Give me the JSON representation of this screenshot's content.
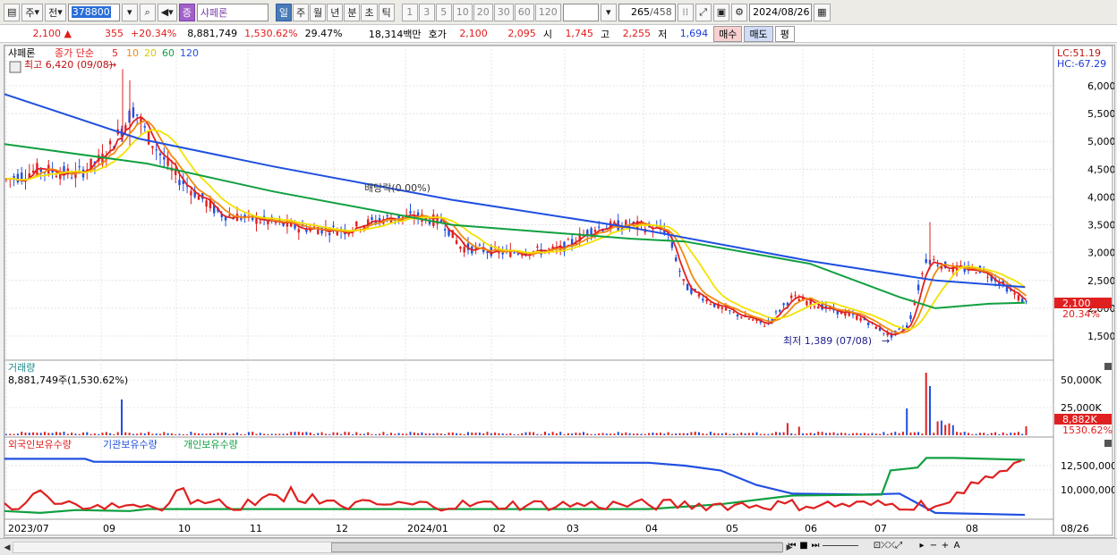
{
  "toolbar": {
    "period_type": "주",
    "prev_label": "전",
    "code": "378800",
    "stock_badge": "증",
    "stock_name": "샤페론",
    "periods": [
      "일",
      "주",
      "월",
      "년",
      "분",
      "초",
      "틱"
    ],
    "intervals": [
      "1",
      "3",
      "5",
      "10",
      "20",
      "30",
      "60",
      "120"
    ],
    "count": "265",
    "total": "/458",
    "date": "2024/08/26"
  },
  "infobar": {
    "price": "2,100",
    "change": "355",
    "change_pct": "+20.34%",
    "volume": "8,881,749",
    "vol_ratio": "1,530.62%",
    "turnover": "29.47%",
    "amount": "18,314백만",
    "ask_label": "호가",
    "ask1": "2,100",
    "ask2": "2,095",
    "open_label": "시",
    "open": "1,745",
    "high_label": "고",
    "high": "2,255",
    "low_label": "저",
    "low": "1,694",
    "buy_label": "매수",
    "sell_label": "매도",
    "eval_label": "평"
  },
  "price_panel": {
    "stock_name": "샤페론",
    "legend_title": "종가 단순",
    "ma_labels": [
      "5",
      "10",
      "20",
      "60",
      "120"
    ],
    "ma_colors": [
      "#e22020",
      "#f08a10",
      "#f2e200",
      "#10a040",
      "#2050e0"
    ],
    "high_annotation": "최고 6,420 (09/08)",
    "low_annotation": "최저 1,389 (07/08)",
    "dividend": "배당락(0.00%)",
    "lc": "LC:51.19",
    "hc": "HC:-67.29",
    "current_price_tag": "2,100",
    "current_pct_tag": "20.34%",
    "y_ticks": [
      "6,000",
      "5,500",
      "5,000",
      "4,500",
      "4,000",
      "3,500",
      "3,000",
      "2,500",
      "2,000",
      "1,500"
    ]
  },
  "volume_panel": {
    "title": "거래량",
    "value": "8,881,749주(1,530.62%)",
    "y_ticks": [
      "50,000K",
      "25,000K"
    ],
    "tag_value": "8,882K",
    "tag_pct": "1530.62%"
  },
  "holding_panel": {
    "series": [
      "외국인보유수량",
      "기관보유수량",
      "개인보유수량"
    ],
    "colors": [
      "#e02020",
      "#2050e0",
      "#10a040"
    ],
    "y_ticks": [
      "12,500,000",
      "10,000,000"
    ]
  },
  "x_axis": [
    "2023/07",
    "09",
    "10",
    "11",
    "12",
    "2024/01",
    "02",
    "03",
    "04",
    "05",
    "06",
    "07",
    "08",
    "08/26"
  ]
}
